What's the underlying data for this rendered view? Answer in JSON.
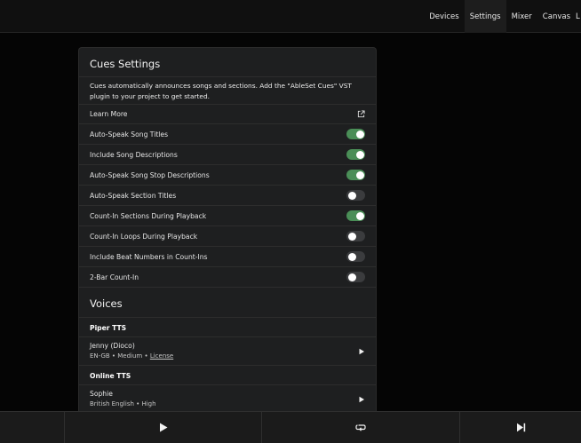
{
  "nav": {
    "items": [
      {
        "label": "Devices"
      },
      {
        "label": "Settings",
        "active": true
      },
      {
        "label": "Mixer"
      },
      {
        "label": "Canvas"
      },
      {
        "label": "L"
      }
    ]
  },
  "cues": {
    "title": "Cues Settings",
    "description": "Cues automatically announces songs and sections. Add the \"AbleSet Cues\" VST plugin to your project to get started.",
    "learn_more": "Learn More",
    "learn_more_icon": "external-link-icon",
    "toggles": [
      {
        "label": "Auto-Speak Song Titles",
        "on": true
      },
      {
        "label": "Include Song Descriptions",
        "on": true
      },
      {
        "label": "Auto-Speak Song Stop Descriptions",
        "on": true
      },
      {
        "label": "Auto-Speak Section Titles",
        "on": false
      },
      {
        "label": "Count-In Sections During Playback",
        "on": true
      },
      {
        "label": "Count-In Loops During Playback",
        "on": false
      },
      {
        "label": "Include Beat Numbers in Count-Ins",
        "on": false
      },
      {
        "label": "2-Bar Count-In",
        "on": false
      }
    ]
  },
  "voices": {
    "title": "Voices",
    "groups": [
      {
        "title": "Piper TTS",
        "voices": [
          {
            "name": "Jenny (Dioco)",
            "meta": "EN-GB • Medium • ",
            "link": "License"
          }
        ]
      },
      {
        "title": "Online TTS",
        "voices": [
          {
            "name": "Sophie",
            "meta": "British English • High",
            "link": ""
          }
        ]
      }
    ]
  },
  "transport": {
    "buttons": [
      {
        "icon": "play-icon"
      },
      {
        "icon": "loop-icon"
      },
      {
        "icon": "skip-next-icon"
      }
    ]
  },
  "colors": {
    "toggle_on": "#4a8e57",
    "toggle_off": "#3b3c3e",
    "panel": "#1e1f20",
    "background": "#050505"
  }
}
